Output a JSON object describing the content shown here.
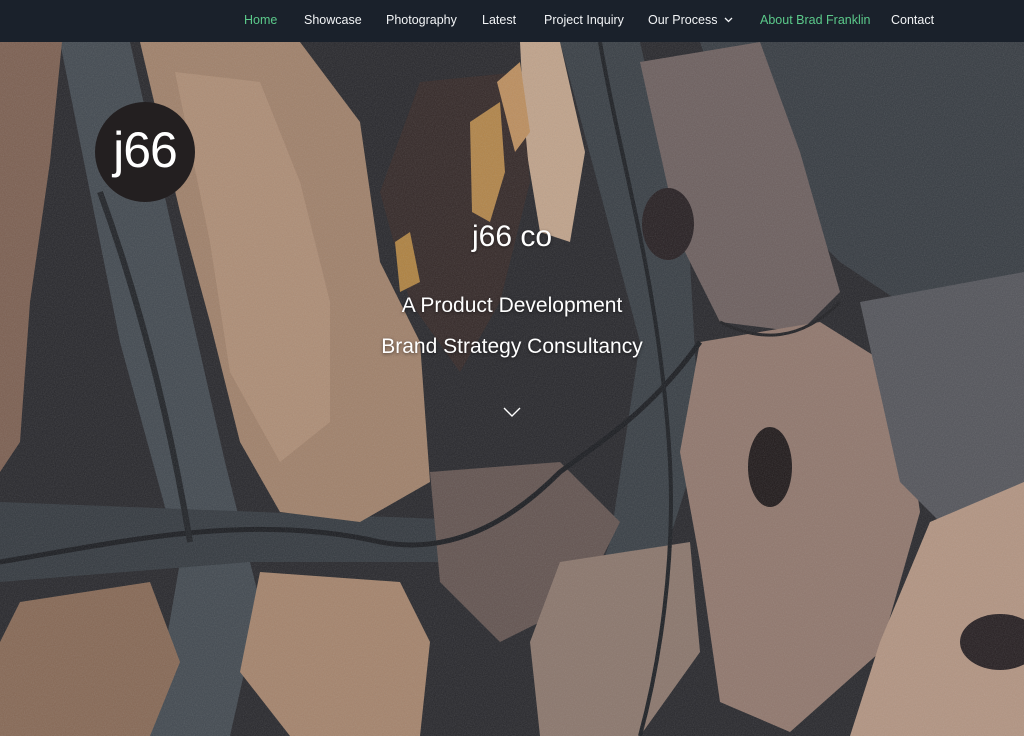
{
  "nav": {
    "items": [
      {
        "label": "Home",
        "active": true
      },
      {
        "label": "Showcase",
        "active": false
      },
      {
        "label": "Photography",
        "active": false
      },
      {
        "label": "Latest",
        "active": false
      },
      {
        "label": "Project Inquiry",
        "active": false
      },
      {
        "label": "Our Process",
        "active": false,
        "has_dropdown": true
      },
      {
        "label": "About Brad Franklin",
        "active": true
      },
      {
        "label": "Contact",
        "active": false
      }
    ]
  },
  "logo": {
    "text": "j66"
  },
  "hero": {
    "title": "j66 co",
    "line1": "A Product Development",
    "line2": "Brand Strategy Consultancy",
    "scroll_icon": "chevron-down-icon"
  },
  "colors": {
    "nav_bg": "#1a212b",
    "nav_text": "#f2f4f6",
    "nav_active": "#5bc98a",
    "logo_bg": "#231f20"
  }
}
